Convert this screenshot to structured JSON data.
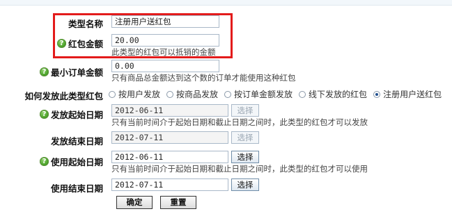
{
  "form": {
    "type_name": {
      "label": "类型名称",
      "value": "注册用户送红包"
    },
    "amount": {
      "label": "红包金额",
      "value": "20.00",
      "note": "此类型的红包可以抵销的金额"
    },
    "min_order": {
      "label": "最小订单金额",
      "value": "0.00",
      "note": "只有商品总金额达到这个数的订单才能使用这种红包"
    },
    "send_method": {
      "label": "如何发放此类型红包",
      "options": [
        "按用户发放",
        "按商品发放",
        "按订单金额发放",
        "线下发放的红包",
        "注册用户送红包"
      ],
      "selected": "注册用户送红包"
    },
    "send_start": {
      "label": "发放起始日期",
      "value": "2012-06-11",
      "button": "选择",
      "note": "只有当前时间介于起始日期和截止日期之间时，此类型的红包才可以发放"
    },
    "send_end": {
      "label": "发放结束日期",
      "value": "2012-07-11",
      "button": "选择"
    },
    "use_start": {
      "label": "使用起始日期",
      "value": "2012-06-11",
      "button": "选择",
      "note": "只有当前时间介于起始日期和截止日期之间时，此类型的红包才可以使用"
    },
    "use_end": {
      "label": "使用结束日期",
      "value": "2012-07-11",
      "button": "选择"
    },
    "submit_label": "确定",
    "reset_label": "重置"
  },
  "icons": {
    "help": "help-icon"
  },
  "colors": {
    "highlight": "#e31b1b",
    "help_icon": "#3f9a1f"
  }
}
